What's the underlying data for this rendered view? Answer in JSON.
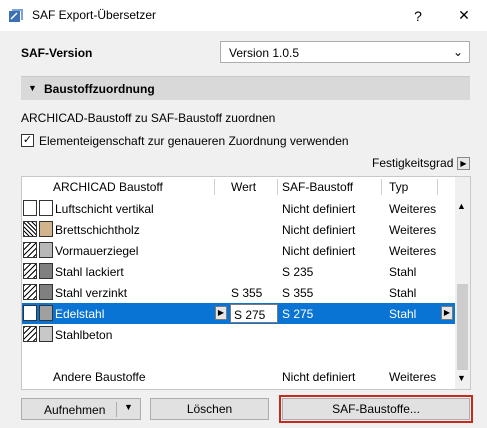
{
  "window": {
    "title": "SAF Export-Übersetzer",
    "help_label": "?",
    "close_label": "✕"
  },
  "version": {
    "label": "SAF-Version",
    "selected": "Version 1.0.5"
  },
  "section": {
    "title": "Baustoffzuordnung"
  },
  "description": "ARCHICAD-Baustoff zu SAF-Baustoff zuordnen",
  "option": {
    "label": "Elementeigenschaft zur genaueren Zuordnung verwenden",
    "checked": true
  },
  "strength_label": "Festigkeitsgrad",
  "table": {
    "columns": [
      "ARCHICAD Baustoff",
      "Wert",
      "SAF-Baustoff",
      "Typ"
    ],
    "rows": [
      {
        "name": "Luftschicht vertikal",
        "wert": "",
        "saf": "Nicht definiert",
        "typ": "Weiteres",
        "swatch": "#ffffff",
        "pattern": "none"
      },
      {
        "name": "Brettschichtholz",
        "wert": "",
        "saf": "Nicht definiert",
        "typ": "Weiteres",
        "swatch": "#d1b48c",
        "pattern": "cross"
      },
      {
        "name": "Vormauerziegel",
        "wert": "",
        "saf": "Nicht definiert",
        "typ": "Weiteres",
        "swatch": "#b8b8b8",
        "pattern": "hatch"
      },
      {
        "name": "Stahl lackiert",
        "wert": "",
        "saf": "S 235",
        "typ": "Stahl",
        "swatch": "#808080",
        "pattern": "hatch"
      },
      {
        "name": "Stahl verzinkt",
        "wert": "S 355",
        "saf": "S 355",
        "typ": "Stahl",
        "swatch": "#808080",
        "pattern": "hatch"
      },
      {
        "name": "Edelstahl",
        "wert": "S 275",
        "saf": "S 275",
        "typ": "Stahl",
        "swatch": "#a0a0a0",
        "pattern": "none",
        "selected": true
      },
      {
        "name": "Stahlbeton",
        "wert": "",
        "saf": "",
        "typ": "",
        "swatch": "#c8c8c8",
        "pattern": "hatch"
      }
    ],
    "other": {
      "name": "Andere Baustoffe",
      "saf": "Nicht definiert",
      "typ": "Weiteres"
    }
  },
  "buttons": {
    "add": "Aufnehmen",
    "delete": "Löschen",
    "saf_materials": "SAF-Baustoffe..."
  },
  "colors": {
    "selection": "#0a74d4",
    "highlight_border": "#c42b1c"
  }
}
